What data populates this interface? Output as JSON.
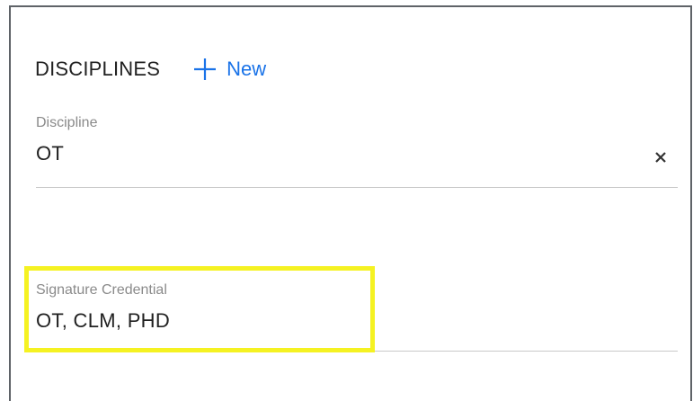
{
  "section": {
    "title": "DISCIPLINES",
    "new_label": "New"
  },
  "discipline_field": {
    "label": "Discipline",
    "value": "OT"
  },
  "signature_field": {
    "label": "Signature Credential",
    "value": "OT, CLM, PHD"
  },
  "colors": {
    "accent": "#1a73e8",
    "highlight": "#f5f222",
    "text": "#212121",
    "label": "#8a8a8a",
    "divider": "#c9c9c9"
  },
  "icons": {
    "new": "plus-icon",
    "clear": "close-icon"
  }
}
